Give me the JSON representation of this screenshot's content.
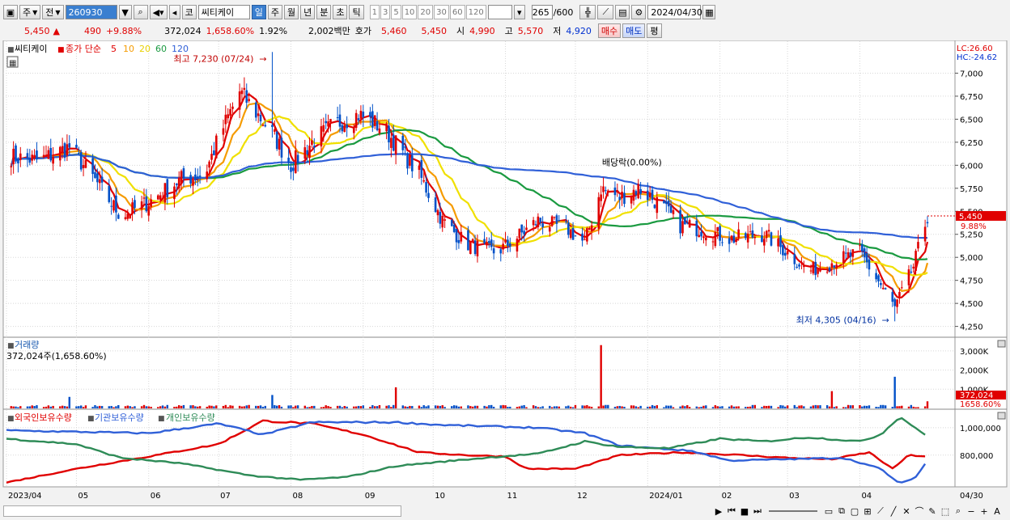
{
  "toolbar": {
    "market": "주",
    "mode": "전",
    "code": "260930",
    "type_label": "코",
    "name": "씨티케이",
    "periods": [
      "일",
      "주",
      "월",
      "년",
      "분",
      "초",
      "틱"
    ],
    "active_period": "일",
    "intervals": [
      "1",
      "3",
      "5",
      "10",
      "20",
      "30",
      "60",
      "120"
    ],
    "count": "265",
    "count_max": "/600",
    "date": "2024/04/30"
  },
  "quote": {
    "price": "5,450",
    "change_arrow": "▲",
    "change": "490",
    "change_pct": "+9.88%",
    "volume": "372,024",
    "volume_pct": "1,658.60%",
    "turnover_pct": "1.92%",
    "amount": "2,002백만",
    "ask_label": "호가",
    "ask1": "5,460",
    "ask2": "5,450",
    "open_label": "시",
    "open": "4,990",
    "high_label": "고",
    "high": "5,570",
    "low_label": "저",
    "low": "4,920",
    "buy_label": "매수",
    "sell_label": "매도",
    "eval_label": "평"
  },
  "chart_data": [
    {
      "type": "candlestick",
      "legend": {
        "name": "씨티케이",
        "ma_label": "종가 단순",
        "ma_periods": [
          "5",
          "10",
          "20",
          "60",
          "120"
        ]
      },
      "ylim": [
        4150,
        7250
      ],
      "yticks": [
        "7,000",
        "6,750",
        "6,500",
        "6,250",
        "6,000",
        "5,750",
        "5,500",
        "5,250",
        "5,000",
        "4,750",
        "4,500",
        "4,250"
      ],
      "ytick_values": [
        7000,
        6750,
        6500,
        6250,
        6000,
        5750,
        5500,
        5250,
        5000,
        4750,
        4500,
        4250
      ],
      "x_labels": [
        "2023/04",
        "05",
        "06",
        "07",
        "08",
        "09",
        "10",
        "11",
        "12",
        "2024/01",
        "02",
        "03",
        "04"
      ],
      "x_label_dates": [
        "2023-04-01",
        "2023-05-01",
        "2023-06-01",
        "2023-07-01",
        "2023-08-01",
        "2023-09-01",
        "2023-10-01",
        "2023-11-01",
        "2023-12-01",
        "2024-01-01",
        "2024-02-01",
        "2024-03-01",
        "2024-04-01"
      ],
      "x_range": [
        "2023-04-01",
        "2024-04-30"
      ],
      "x_right_label": "04/30",
      "close_points": [
        [
          "2023-04-01",
          6100
        ],
        [
          "2023-04-15",
          6050
        ],
        [
          "2023-04-28",
          6200
        ],
        [
          "2023-05-10",
          5800
        ],
        [
          "2023-05-20",
          5450
        ],
        [
          "2023-06-01",
          5600
        ],
        [
          "2023-06-15",
          5850
        ],
        [
          "2023-06-25",
          5900
        ],
        [
          "2023-07-01",
          6300
        ],
        [
          "2023-07-10",
          6800
        ],
        [
          "2023-07-24",
          6350
        ],
        [
          "2023-08-01",
          6000
        ],
        [
          "2023-08-10",
          6250
        ],
        [
          "2023-08-20",
          6450
        ],
        [
          "2023-08-30",
          6550
        ],
        [
          "2023-09-10",
          6400
        ],
        [
          "2023-09-25",
          5900
        ],
        [
          "2023-10-05",
          5400
        ],
        [
          "2023-10-15",
          5150
        ],
        [
          "2023-10-28",
          5050
        ],
        [
          "2023-11-05",
          5200
        ],
        [
          "2023-11-15",
          5400
        ],
        [
          "2023-11-28",
          5300
        ],
        [
          "2023-12-05",
          5150
        ],
        [
          "2023-12-12",
          5750
        ],
        [
          "2023-12-20",
          5650
        ],
        [
          "2023-12-28",
          5750
        ],
        [
          "2024-01-05",
          5600
        ],
        [
          "2024-01-15",
          5350
        ],
        [
          "2024-01-25",
          5300
        ],
        [
          "2024-02-05",
          5200
        ],
        [
          "2024-02-20",
          5250
        ],
        [
          "2024-03-01",
          5050
        ],
        [
          "2024-03-10",
          4850
        ],
        [
          "2024-03-20",
          4950
        ],
        [
          "2024-04-01",
          5050
        ],
        [
          "2024-04-10",
          4700
        ],
        [
          "2024-04-16",
          4450
        ],
        [
          "2024-04-24",
          4900
        ],
        [
          "2024-04-30",
          5450
        ]
      ],
      "annotations": {
        "high_label": "최고 7,230 (07/24)",
        "high_date": "2023-07-24",
        "high_value": 7230,
        "low_label": "최저 4,305 (04/16)",
        "low_date": "2024-04-16",
        "low_value": 4305,
        "event_label": "배당락(0.00%)",
        "event_date": "2023-12-27"
      },
      "last_price": "5,450",
      "last_pct": "9.88%",
      "lc": "LC:26.60",
      "hc": "HC:-24.62",
      "colors": {
        "up": "#e00000",
        "down": "#0050c8",
        "ma5": "#e00000",
        "ma10": "#f59b00",
        "ma20": "#f0e000",
        "ma60": "#1a9a40",
        "ma120": "#3060d8"
      }
    },
    {
      "type": "bar",
      "title": "거래량",
      "subtitle": "372,024주(1,658.60%)",
      "yticks": [
        "3,000K",
        "2,000K",
        "1,000K"
      ],
      "ytick_values": [
        3000,
        2000,
        1000
      ],
      "ylim": [
        0,
        3500
      ],
      "spikes": [
        [
          "2023-04-28",
          600
        ],
        [
          "2023-07-24",
          700
        ],
        [
          "2023-09-15",
          1100
        ],
        [
          "2023-12-12",
          3300
        ],
        [
          "2024-03-20",
          900
        ],
        [
          "2024-04-16",
          1650
        ],
        [
          "2024-04-30",
          370
        ]
      ],
      "last_value": "372,024",
      "last_pct": "1658.60%"
    },
    {
      "type": "line",
      "series": [
        {
          "name": "외국인보유수량",
          "color": "#e00000"
        },
        {
          "name": "기관보유수량",
          "color": "#3060d8"
        },
        {
          "name": "개인보유수량",
          "color": "#2e8b57"
        }
      ],
      "yticks": [
        "1,000,000",
        "800,000"
      ],
      "ytick_values": [
        1000000,
        800000
      ],
      "ylim": [
        580000,
        1100000
      ],
      "foreign": [
        [
          "2023-04-01",
          600000
        ],
        [
          "2023-05-01",
          700000
        ],
        [
          "2023-06-01",
          790000
        ],
        [
          "2023-07-01",
          880000
        ],
        [
          "2023-07-20",
          1050000
        ],
        [
          "2023-08-10",
          1030000
        ],
        [
          "2023-09-01",
          950000
        ],
        [
          "2023-09-25",
          820000
        ],
        [
          "2023-10-15",
          800000
        ],
        [
          "2023-11-01",
          790000
        ],
        [
          "2023-11-10",
          700000
        ],
        [
          "2023-12-01",
          700000
        ],
        [
          "2023-12-20",
          800000
        ],
        [
          "2024-01-15",
          820000
        ],
        [
          "2024-02-10",
          800000
        ],
        [
          "2024-03-01",
          780000
        ],
        [
          "2024-03-20",
          770000
        ],
        [
          "2024-04-05",
          820000
        ],
        [
          "2024-04-15",
          700000
        ],
        [
          "2024-04-22",
          800000
        ],
        [
          "2024-04-30",
          790000
        ]
      ],
      "institution": [
        [
          "2023-04-01",
          980000
        ],
        [
          "2023-06-01",
          960000
        ],
        [
          "2023-07-01",
          1030000
        ],
        [
          "2023-07-20",
          950000
        ],
        [
          "2023-08-10",
          1040000
        ],
        [
          "2023-09-15",
          1040000
        ],
        [
          "2023-10-05",
          1020000
        ],
        [
          "2023-11-15",
          1000000
        ],
        [
          "2023-12-05",
          960000
        ],
        [
          "2023-12-20",
          870000
        ],
        [
          "2024-01-20",
          830000
        ],
        [
          "2024-02-05",
          760000
        ],
        [
          "2024-03-01",
          770000
        ],
        [
          "2024-03-25",
          780000
        ],
        [
          "2024-04-10",
          700000
        ],
        [
          "2024-04-18",
          590000
        ],
        [
          "2024-04-25",
          640000
        ],
        [
          "2024-04-30",
          760000
        ]
      ],
      "individual": [
        [
          "2023-04-01",
          920000
        ],
        [
          "2023-05-01",
          880000
        ],
        [
          "2023-05-20",
          780000
        ],
        [
          "2023-06-15",
          740000
        ],
        [
          "2023-07-15",
          650000
        ],
        [
          "2023-08-05",
          620000
        ],
        [
          "2023-08-25",
          640000
        ],
        [
          "2023-09-15",
          720000
        ],
        [
          "2023-10-10",
          760000
        ],
        [
          "2023-10-30",
          790000
        ],
        [
          "2023-11-15",
          810000
        ],
        [
          "2023-12-05",
          900000
        ],
        [
          "2023-12-20",
          860000
        ],
        [
          "2024-01-10",
          850000
        ],
        [
          "2024-02-01",
          920000
        ],
        [
          "2024-02-20",
          900000
        ],
        [
          "2024-03-10",
          930000
        ],
        [
          "2024-04-01",
          900000
        ],
        [
          "2024-04-10",
          950000
        ],
        [
          "2024-04-18",
          1080000
        ],
        [
          "2024-04-25",
          1000000
        ],
        [
          "2024-04-30",
          930000
        ]
      ]
    }
  ]
}
